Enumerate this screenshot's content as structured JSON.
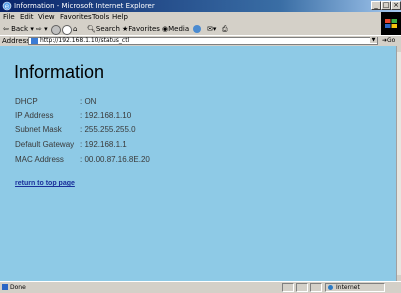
{
  "window": {
    "title": "Information - Microsoft Internet Explorer"
  },
  "menu": [
    "File",
    "Edit",
    "View",
    "Favorites",
    "Tools",
    "Help"
  ],
  "toolbar": {
    "back": "Back",
    "search": "Search",
    "favorites": "Favorites",
    "media": "Media"
  },
  "address": {
    "label": "Address",
    "url": "http://192.168.1.10/status_ctl",
    "go": "Go"
  },
  "page": {
    "heading": "Information",
    "rows": [
      {
        "label": "DHCP",
        "value": ": ON"
      },
      {
        "label": "IP Address",
        "value": ": 192.168.1.10"
      },
      {
        "label": "Subnet Mask",
        "value": ": 255.255.255.0"
      },
      {
        "label": "Default Gateway",
        "value": ": 192.168.1.1"
      },
      {
        "label": "MAC Address",
        "value": ": 00.00.87.16.8E.20"
      }
    ],
    "link": "return to top page"
  },
  "status": {
    "text": "Done",
    "zone": "Internet"
  },
  "colors": {
    "content_bg": "#8ecae6",
    "link": "#1a2f9a",
    "titlebar": "#0a246a"
  }
}
